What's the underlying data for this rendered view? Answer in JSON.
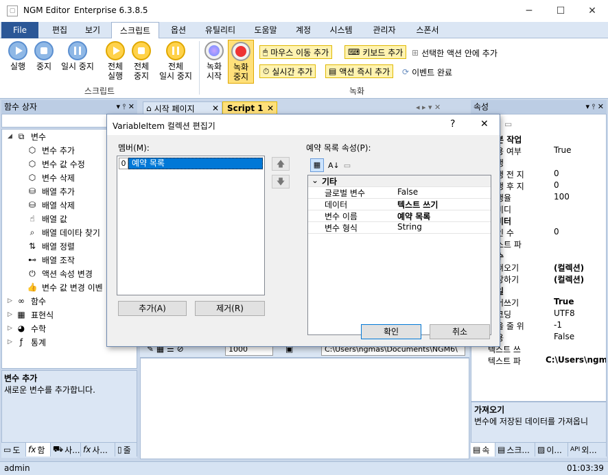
{
  "window": {
    "app": "NGM Editor",
    "edition": "Enterprise 6.3.8.5",
    "min": "─",
    "max": "☐",
    "close": "✕"
  },
  "menu": [
    "File",
    "편집",
    "보기",
    "스크립트",
    "옵션",
    "유틸리티",
    "도움말",
    "계정",
    "시스템",
    "관리자",
    "스폰서"
  ],
  "ribbon": {
    "run": "실행",
    "stop": "중지",
    "pause": "일시 중지",
    "all_run_1": "전체",
    "all_run_2": "실행",
    "all_stop_1": "전체",
    "all_stop_2": "중지",
    "all_pause_1": "전체",
    "all_pause_2": "일시 중지",
    "rec_start_1": "녹화",
    "rec_start_2": "시작",
    "rec_stop_1": "녹화",
    "rec_stop_2": "중지",
    "mouse_add": "마우스 이동 추가",
    "key_add": "키보드 추가",
    "action_in": "선택한 액션 안에 추가",
    "realtime_add": "실시간 추가",
    "action_now_add": "액션 즉시 추가",
    "event_done": "이벤트 완료",
    "group_script": "스크립트",
    "group_record": "녹화"
  },
  "left_panel": {
    "title": "함수 상자",
    "tree": [
      {
        "label": "변수",
        "icon": "variable-icon",
        "level": 0,
        "expanded": true
      },
      {
        "label": "변수 추가",
        "icon": "cube-add-icon",
        "level": 1
      },
      {
        "label": "변수 값 수정",
        "icon": "cube-edit-icon",
        "level": 1
      },
      {
        "label": "변수 삭제",
        "icon": "cube-delete-icon",
        "level": 1
      },
      {
        "label": "배열 추가",
        "icon": "database-add-icon",
        "level": 1
      },
      {
        "label": "배열 삭제",
        "icon": "database-delete-icon",
        "level": 1
      },
      {
        "label": "배열 값",
        "icon": "pointer-icon",
        "level": 1
      },
      {
        "label": "배열 데이타 찾기",
        "icon": "search-icon",
        "level": 1
      },
      {
        "label": "배열 정렬",
        "icon": "sort-icon",
        "level": 1
      },
      {
        "label": "배열 조작",
        "icon": "toggle-icon",
        "level": 1
      },
      {
        "label": "액션 속성 변경",
        "icon": "power-icon",
        "level": 1
      },
      {
        "label": "변수 값 변경 이벤",
        "icon": "thumbs-up-icon",
        "level": 1
      },
      {
        "label": "함수",
        "icon": "infinity-icon",
        "level": 0,
        "expanded": false
      },
      {
        "label": "표현식",
        "icon": "grid-icon",
        "level": 0,
        "expanded": false
      },
      {
        "label": "수학",
        "icon": "pie-icon",
        "level": 0,
        "expanded": false
      },
      {
        "label": "통계",
        "icon": "fx-icon",
        "level": 0,
        "expanded": false
      }
    ],
    "desc_title": "변수 추가",
    "desc_text": "새로운 변수를 추가합니다.",
    "tabs": [
      "도",
      "함",
      "사...",
      "사...",
      "줄"
    ]
  },
  "center": {
    "tabs": [
      "시작 페이지",
      "Script 1"
    ],
    "toolbar_num": "1000",
    "toolbar_path": "C:\\Users\\ngmas\\Documents\\NGM6\\"
  },
  "right_panel": {
    "title": "속성",
    "rows": [
      {
        "k": "본 작업",
        "v": "",
        "bold": true,
        "section": true
      },
      {
        "k": "용 여부",
        "v": "True"
      },
      {
        "k": "행",
        "v": ""
      },
      {
        "k": "행 전 지",
        "v": "0"
      },
      {
        "k": "행 후 지",
        "v": "0"
      },
      {
        "k": "행율",
        "v": "100"
      },
      {
        "k": "비디",
        "v": ""
      },
      {
        "k": "미터",
        "v": "",
        "section": true
      },
      {
        "k": "인 수",
        "v": "0"
      },
      {
        "k": "스트 파",
        "v": ""
      },
      {
        "k": "수",
        "v": "",
        "section": true
      },
      {
        "k": "져오기",
        "v": "(컬렉션)",
        "bold": true
      },
      {
        "k": "장하기",
        "v": "(컬렉션)",
        "bold": true
      },
      {
        "k": "일",
        "v": "",
        "section": true
      },
      {
        "k": "어쓰기",
        "v": "True",
        "bold": true
      },
      {
        "k": "코딩",
        "v": "UTF8"
      },
      {
        "k": "을 줄 위",
        "v": "-1"
      },
      {
        "k": "용",
        "v": "False"
      },
      {
        "k": "텍스트 쓰",
        "v": ""
      },
      {
        "k": "텍스트 파",
        "v": "C:\\Users\\ngma",
        "bold": true
      }
    ],
    "desc_title": "가져오기",
    "desc_text": "변수에 저장된 데이터를 가져옵니",
    "tabs": [
      "속",
      "스크...",
      "이...",
      "외..."
    ]
  },
  "dialog": {
    "title": "VariableItem 컬렉션 편집기",
    "help": "?",
    "close": "✕",
    "members_label": "멤버(M):",
    "members": [
      {
        "index": "0",
        "name": "예약 목록"
      }
    ],
    "props_label": "예약 목록 속성(P):",
    "category": "기타",
    "props": [
      {
        "k": "글로벌 변수",
        "v": "False",
        "bold": false
      },
      {
        "k": "데이터",
        "v": "텍스트 쓰기",
        "bold": true
      },
      {
        "k": "변수 이름",
        "v": "예약 목록",
        "bold": true
      },
      {
        "k": "변수 형식",
        "v": "String",
        "bold": false
      }
    ],
    "add": "추가(A)",
    "remove": "제거(R)",
    "ok": "확인",
    "cancel": "취소"
  },
  "status": {
    "user": "admin",
    "time": "01:03:39"
  }
}
